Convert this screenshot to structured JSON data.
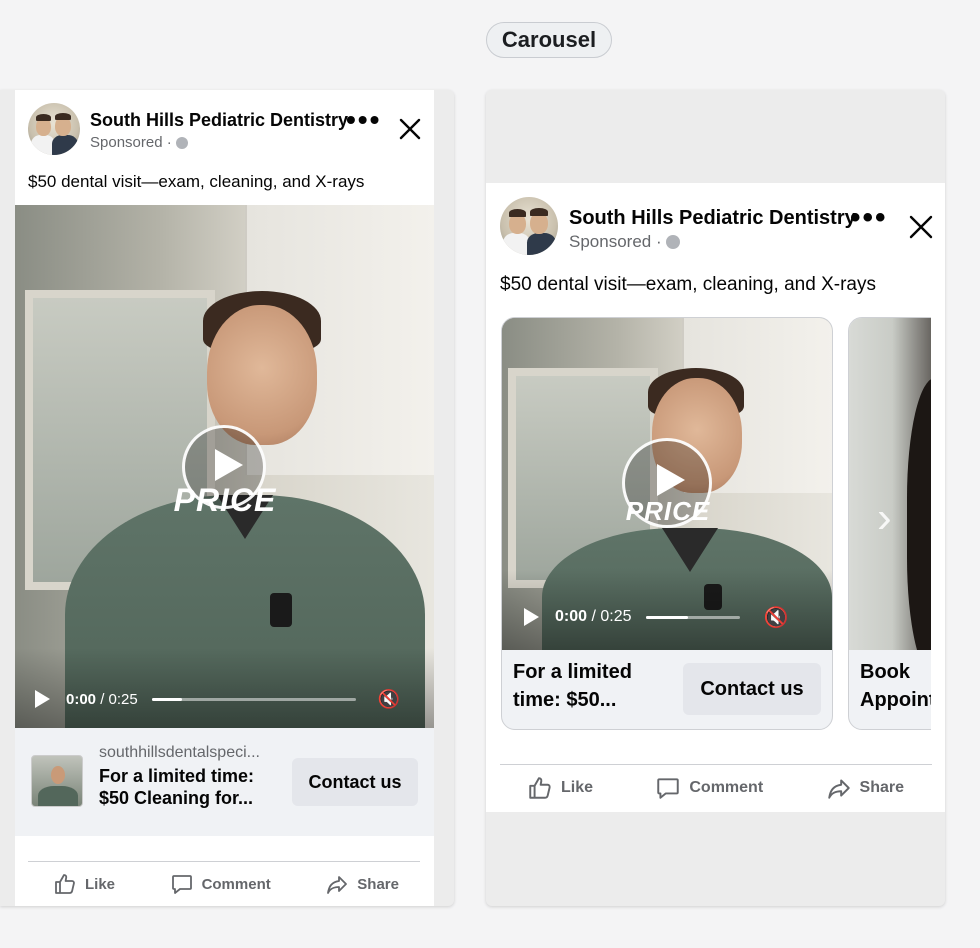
{
  "section_label": "Carousel",
  "left_ad": {
    "page_name": "South Hills Pediatric Dentistry",
    "sponsored": "Sponsored ·",
    "caption": "$50 dental visit—exam, cleaning, and X-rays",
    "video_overlay_text": "PRICE",
    "video": {
      "current_time": "0:00",
      "duration": "/ 0:25",
      "progress": 0.15,
      "mute_icon": "🔇"
    },
    "cta": {
      "domain": "southhillsdentalspeci...",
      "headline": "For a limited time: $50 Cleaning for...",
      "button": "Contact us"
    }
  },
  "right_ad": {
    "page_name": "South Hills Pediatric Dentistry",
    "sponsored": "Sponsored ·",
    "caption": "$50 dental visit—exam, cleaning, and X-rays",
    "carousel": [
      {
        "video_overlay_text": "PRICE",
        "video": {
          "current_time": "0:00",
          "duration": "/ 0:25",
          "progress": 0.45,
          "mute_icon": "🔇"
        },
        "headline": "For a limited time: $50...",
        "button": "Contact us"
      },
      {
        "headline": "Book Appoint"
      }
    ]
  },
  "actions": {
    "like": "Like",
    "comment": "Comment",
    "share": "Share"
  },
  "icons": {
    "more": "more-options-icon",
    "close": "close-icon",
    "globe": "globe-icon",
    "play": "play-icon",
    "mute": "mute-icon",
    "like": "thumbs-up-icon",
    "comment": "comment-icon",
    "share": "share-icon",
    "next": "chevron-right-icon"
  },
  "colors": {
    "background": "#f4f4f5",
    "text": "#050505",
    "secondary_text": "#65676b",
    "button_bg": "#e4e6eb",
    "cta_strip": "#f0f2f5"
  }
}
